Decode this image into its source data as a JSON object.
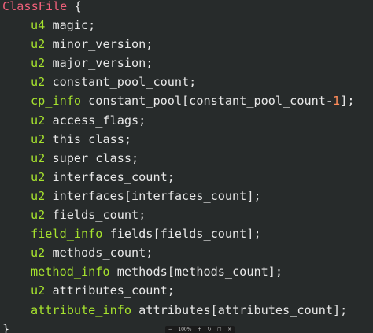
{
  "code": {
    "struct_name": "ClassFile",
    "open_brace": " {",
    "close_brace": "}",
    "fields": [
      {
        "type": "u4",
        "decl": " magic;"
      },
      {
        "type": "u2",
        "decl": " minor_version;"
      },
      {
        "type": "u2",
        "decl": " major_version;"
      },
      {
        "type": "u2",
        "decl": " constant_pool_count;"
      },
      {
        "type": "cp_info",
        "decl": " constant_pool[constant_pool_count-",
        "num": "1",
        "tail": "];"
      },
      {
        "type": "u2",
        "decl": " access_flags;"
      },
      {
        "type": "u2",
        "decl": " this_class;"
      },
      {
        "type": "u2",
        "decl": " super_class;"
      },
      {
        "type": "u2",
        "decl": " interfaces_count;"
      },
      {
        "type": "u2",
        "decl": " interfaces[interfaces_count];"
      },
      {
        "type": "u2",
        "decl": " fields_count;"
      },
      {
        "type": "field_info",
        "decl": " fields[fields_count];"
      },
      {
        "type": "u2",
        "decl": " methods_count;"
      },
      {
        "type": "method_info",
        "decl": " methods[methods_count];"
      },
      {
        "type": "u2",
        "decl": " attributes_count;"
      },
      {
        "type": "attribute_info",
        "decl": " attributes[attributes_count];"
      }
    ]
  },
  "viewer_toolbar": {
    "zoom_out_icon": "minus-icon",
    "zoom_level": "100%",
    "zoom_in_icon": "plus-icon",
    "rotate_icon": "rotate-icon",
    "fit_icon": "fit-icon",
    "close_icon": "close-icon"
  },
  "colors": {
    "background": "#272b2b",
    "struct_name": "#f0607a",
    "type": "#a6e22e",
    "text": "#e8e8e8",
    "number": "#ff8c5a"
  }
}
